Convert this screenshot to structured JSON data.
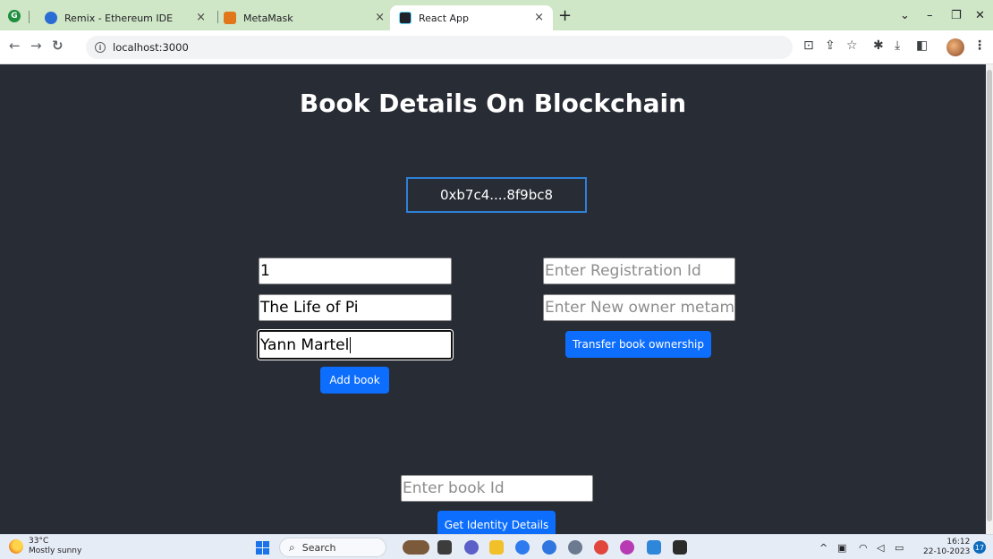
{
  "browser": {
    "profile_badge": "G",
    "tabs": [
      {
        "title": "Remix - Ethereum IDE",
        "icon": "remix-icon"
      },
      {
        "title": "MetaMask",
        "icon": "metamask-fox-icon"
      },
      {
        "title": "React App",
        "icon": "react-icon"
      }
    ],
    "close_glyph": "×",
    "new_tab_glyph": "+",
    "url": "localhost:3000",
    "info_glyph": "i"
  },
  "page": {
    "title": "Book Details On Blockchain",
    "account_address": "0xb7c4....8f9bc8",
    "add_form": {
      "book_id_value": "1",
      "book_name_value": "The Life of Pi",
      "author_value": "Yann Martel",
      "add_button": "Add book"
    },
    "transfer_form": {
      "registration_placeholder": "Enter Registration Id",
      "new_owner_placeholder": "Enter New owner metamask address",
      "transfer_button": "Transfer book ownership"
    },
    "identity_form": {
      "book_id_placeholder": "Enter book Id",
      "get_button": "Get Identity Details"
    }
  },
  "taskbar": {
    "temperature": "33°C",
    "weather": "Mostly sunny",
    "search_label": "Search",
    "time": "16:12",
    "date": "22-10-2023",
    "notification_count": "17"
  },
  "colors": {
    "page_bg": "#282c34",
    "primary_button": "#0d6efd",
    "address_border": "#2f80d8",
    "tabstrip_bg": "#cfe6c7"
  }
}
